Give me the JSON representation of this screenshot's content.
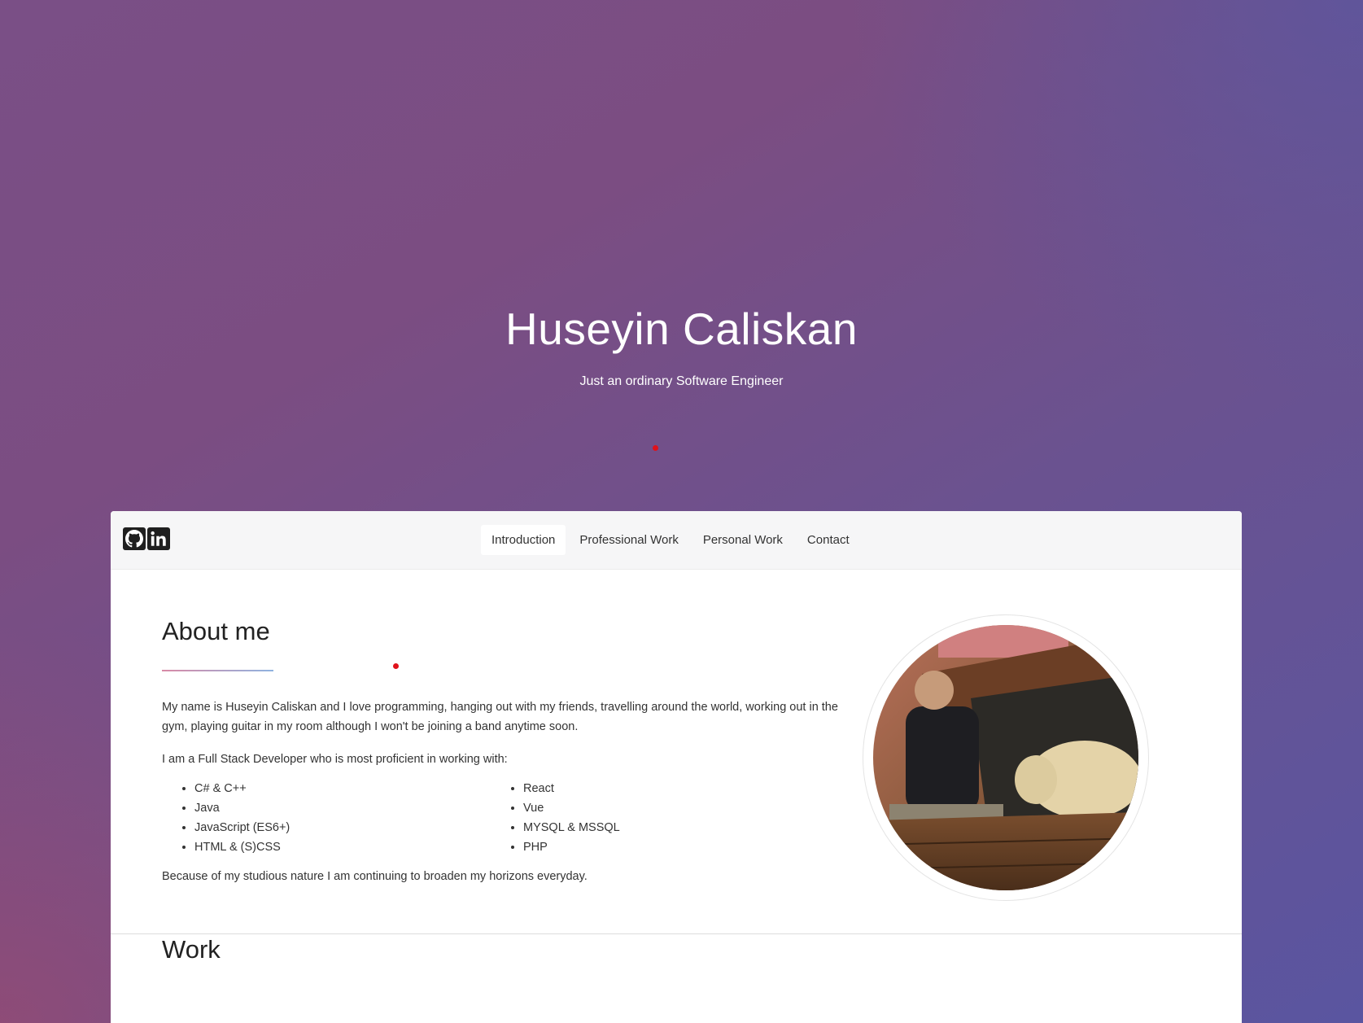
{
  "hero": {
    "title": "Huseyin Caliskan",
    "subtitle": "Just an ordinary Software Engineer"
  },
  "social": {
    "icons": [
      "github-icon",
      "linkedin-icon"
    ]
  },
  "nav": {
    "tabs": [
      {
        "label": "Introduction",
        "active": true
      },
      {
        "label": "Professional Work",
        "active": false
      },
      {
        "label": "Personal Work",
        "active": false
      },
      {
        "label": "Contact",
        "active": false
      }
    ]
  },
  "about": {
    "title": "About me",
    "intro": "My name is Huseyin Caliskan and I love programming, hanging out with my friends, travelling around the world, working out in the gym, playing guitar in my room although I won't be joining a band anytime soon.",
    "skills_lead": "I am a Full Stack Developer who is most proficient in working with:",
    "skills_left": [
      "C# & C++",
      "Java",
      "JavaScript (ES6+)",
      "HTML & (S)CSS"
    ],
    "skills_right": [
      "React",
      "Vue",
      "MYSQL & MSSQL",
      "PHP"
    ],
    "closing": "Because of my studious nature I am continuing to broaden my horizons everyday."
  },
  "work": {
    "title": "Work"
  },
  "colors": {
    "accent_dot": "#e0121b",
    "underline_start": "#d98aa6",
    "underline_end": "#8fb3e0"
  }
}
